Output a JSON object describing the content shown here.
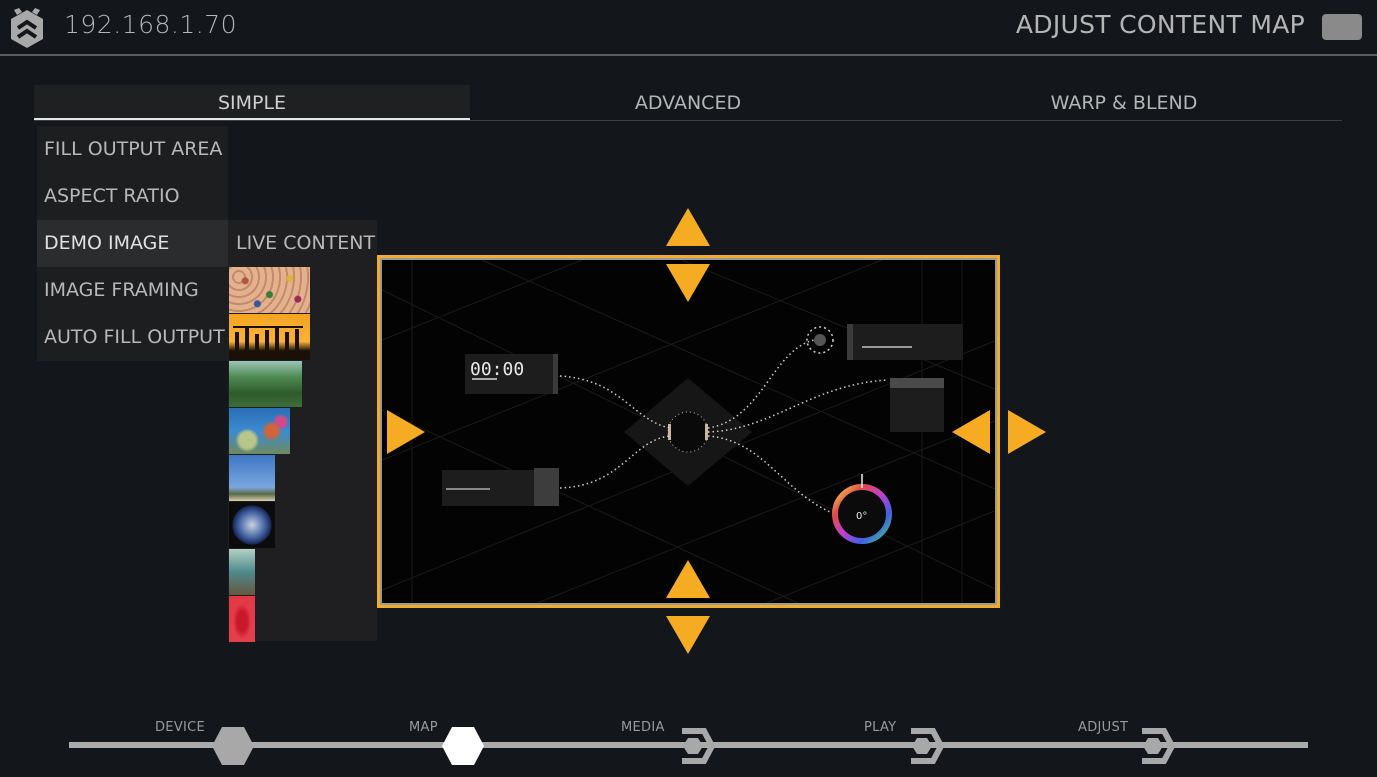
{
  "header": {
    "device_ip": "192.168.1.70",
    "page_title": "ADJUST CONTENT MAP",
    "logo_icon": "hexagon-chevron-logo",
    "menu_icon": "menu-button"
  },
  "tabs": [
    {
      "label": "SIMPLE",
      "active": true
    },
    {
      "label": "ADVANCED",
      "active": false
    },
    {
      "label": "WARP & BLEND",
      "active": false
    }
  ],
  "side_menu": {
    "items": [
      {
        "label": "FILL OUTPUT AREA",
        "active": false
      },
      {
        "label": "ASPECT RATIO",
        "active": false
      },
      {
        "label": "DEMO IMAGE",
        "active": true
      },
      {
        "label": "IMAGE FRAMING",
        "active": false
      },
      {
        "label": "AUTO FILL OUTPUT",
        "active": false
      }
    ]
  },
  "submenu": {
    "label": "LIVE CONTENT",
    "thumbnails": [
      {
        "name": "colored-pencils",
        "colors": [
          "#d9a583",
          "#b5543a",
          "#3e2a20"
        ]
      },
      {
        "name": "jumping-silhouettes-sunset",
        "colors": [
          "#f5a321",
          "#f7c04c",
          "#1a1008"
        ]
      },
      {
        "name": "pine-forest",
        "colors": [
          "#5b8a5e",
          "#2f5b2c",
          "#8fb3a0"
        ]
      },
      {
        "name": "coral-reef-fish",
        "colors": [
          "#2a6fb5",
          "#d0643a",
          "#b7c78a"
        ]
      },
      {
        "name": "jumping-person-sky",
        "colors": [
          "#3d77c4",
          "#7aa6df",
          "#5c6b45"
        ]
      },
      {
        "name": "earth-globe",
        "colors": [
          "#0b0b0b",
          "#3b5a9a",
          "#c7d3e6"
        ]
      },
      {
        "name": "runner-sunlight",
        "colors": [
          "#4d8a8c",
          "#b4d1c4",
          "#675740"
        ]
      },
      {
        "name": "woman-red-dress",
        "colors": [
          "#e23845",
          "#c9182a",
          "#f1d0c2"
        ]
      }
    ]
  },
  "preview": {
    "demo_clock": "00:00",
    "hue_value": "0°",
    "border_color": "#f0ac2a",
    "arrow_color": "#f5ac22",
    "arrows": [
      "top-edge-up",
      "top-edge-down",
      "bottom-edge-up",
      "bottom-edge-down",
      "left-edge-right",
      "right-edge-left",
      "right-edge-right"
    ]
  },
  "workflow": {
    "steps": [
      {
        "label": "DEVICE",
        "state": "done"
      },
      {
        "label": "MAP",
        "state": "current"
      },
      {
        "label": "MEDIA",
        "state": "pending"
      },
      {
        "label": "PLAY",
        "state": "pending"
      },
      {
        "label": "ADJUST",
        "state": "pending"
      }
    ]
  }
}
